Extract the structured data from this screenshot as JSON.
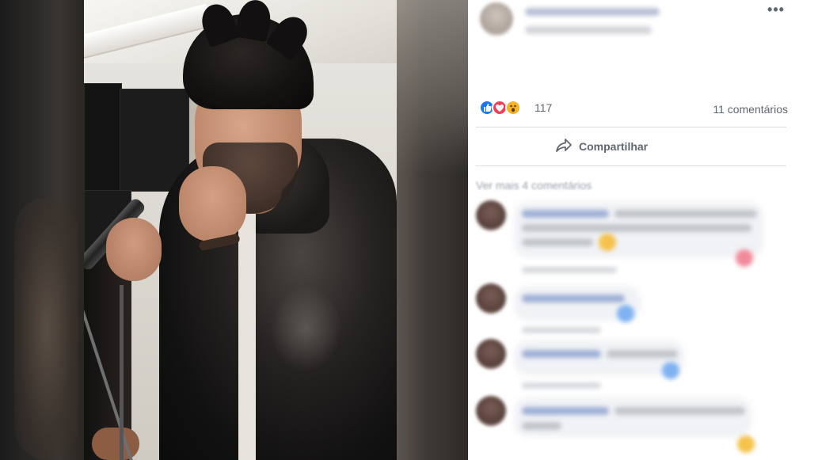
{
  "post": {
    "more_options": "•••",
    "reaction_icons": [
      "like-icon",
      "love-icon",
      "wow-icon"
    ],
    "reaction_count": "117",
    "comments_count": "11 comentários",
    "share_label": "Compartilhar",
    "more_comments_label": "Ver mais 4 comentários"
  },
  "colors": {
    "like": "#1877f2",
    "love": "#f33e58",
    "wow": "#f7b125",
    "secondary_text": "#606770",
    "divider": "#dadde1"
  }
}
